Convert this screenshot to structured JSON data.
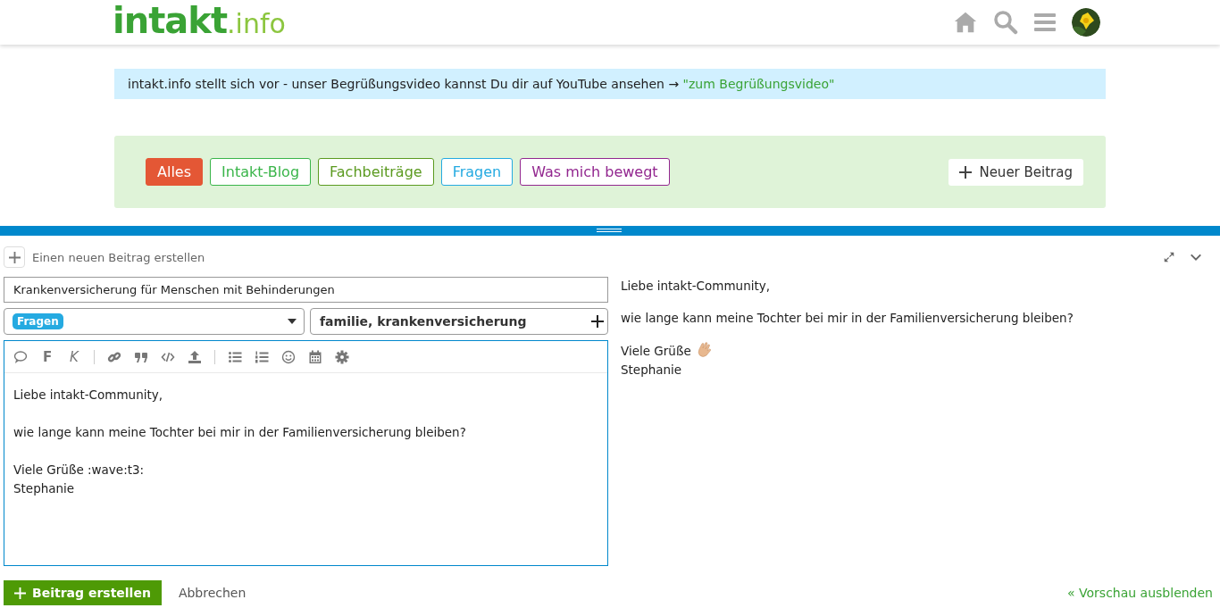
{
  "logo": {
    "name": "intakt",
    "suffix": ".info"
  },
  "banner": {
    "text": "intakt.info stellt sich vor - unser Begrüßungsvideo kannst Du dir auf YouTube ansehen → ",
    "link": "\"zum Begrüßungsvideo\""
  },
  "categories": [
    {
      "label": "Alles",
      "selected": true,
      "color": "#e45735"
    },
    {
      "label": "Intakt-Blog",
      "selected": false,
      "color": "#3ab54a"
    },
    {
      "label": "Fachbeiträge",
      "selected": false,
      "color": "#5b9a20"
    },
    {
      "label": "Fragen",
      "selected": false,
      "color": "#25aae1"
    },
    {
      "label": "Was mich bewegt",
      "selected": false,
      "color": "#92278f"
    }
  ],
  "new_post_button": "Neuer Beitrag",
  "composer": {
    "title": "Einen neuen Beitrag erstellen",
    "topic_title": "Krankenversicherung für Menschen mit Behinderungen",
    "category": {
      "label": "Fragen",
      "color": "#25aae1"
    },
    "tags": "familie, krankenversicherung",
    "toolbar": [
      {
        "kind": "speech"
      },
      {
        "kind": "bold",
        "label": "F"
      },
      {
        "kind": "italic",
        "label": "K"
      },
      {
        "kind": "sep"
      },
      {
        "kind": "link"
      },
      {
        "kind": "quote"
      },
      {
        "kind": "code"
      },
      {
        "kind": "upload"
      },
      {
        "kind": "sep"
      },
      {
        "kind": "bullets"
      },
      {
        "kind": "numbers"
      },
      {
        "kind": "smile"
      },
      {
        "kind": "calendar"
      },
      {
        "kind": "gear"
      }
    ],
    "editor_paragraphs": [
      [
        "Liebe intakt-Community,"
      ],
      [
        "wie lange kann meine Tochter bei mir in der Familienversicherung bleiben?"
      ],
      [
        "Viele Grüße :wave:t3:",
        "Stephanie"
      ]
    ],
    "preview_paragraphs": [
      [
        "Liebe intakt-Community,"
      ],
      [
        "wie lange kann meine Tochter bei mir in der Familienversicherung bleiben?"
      ],
      [
        "Viele Grüße",
        "Stephanie"
      ]
    ],
    "submit": "Beitrag erstellen",
    "cancel": "Abbrechen",
    "hide_preview": "« Vorschau ausblenden"
  }
}
